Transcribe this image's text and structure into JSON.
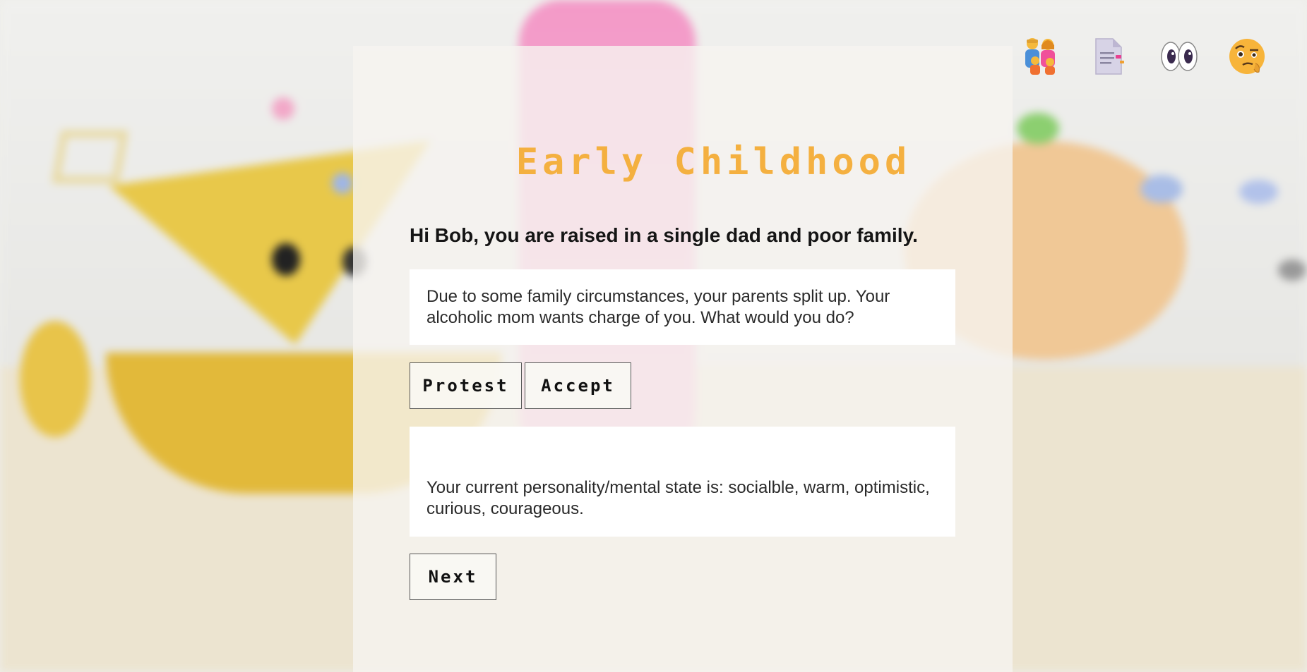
{
  "scene": {
    "title": "Early Childhood",
    "intro": "Hi Bob, you are raised in a single dad and poor family.",
    "question": "Due to some family circumstances, your parents split up. Your alcoholic mom wants charge of you. What would you do?",
    "choices": [
      "Protest",
      "Accept"
    ],
    "state_text": "Your current personality/mental state is: socialble, warm, optimistic, curious, courageous.",
    "next_label": "Next"
  },
  "top_icons": [
    "family-icon",
    "document-icon",
    "eyes-icon",
    "face-with-raised-eyebrow-icon"
  ],
  "colors": {
    "title": "#f4b040",
    "panel": "#f6f4f0",
    "box": "#ffffff",
    "button_border": "#555555"
  }
}
